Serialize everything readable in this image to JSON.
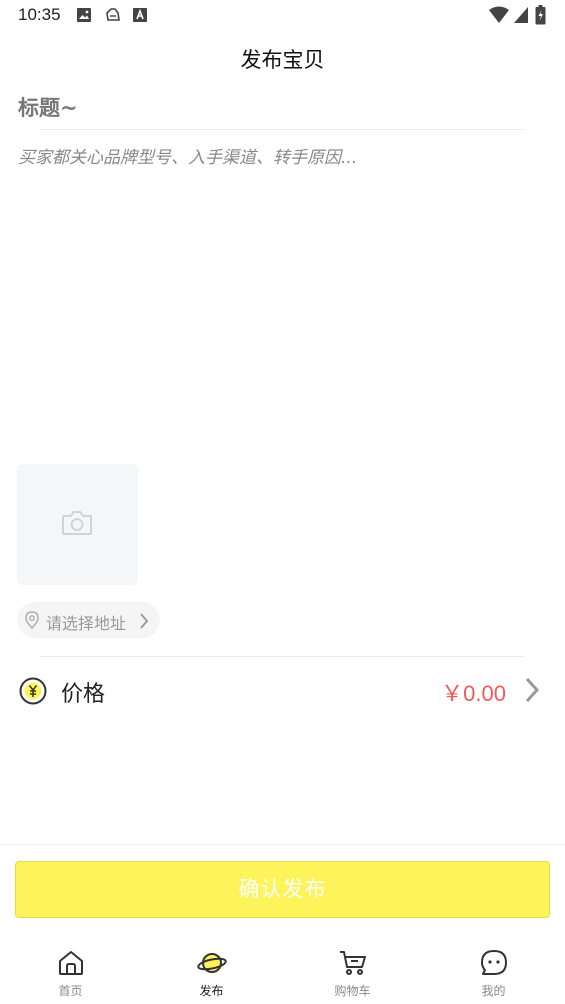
{
  "status_bar": {
    "time": "10:35"
  },
  "header": {
    "title": "发布宝贝"
  },
  "form": {
    "title_placeholder": "标题~",
    "description_placeholder": "买家都关心品牌型号、入手渠道、转手原因...",
    "location_label": "请选择地址",
    "price_label": "价格",
    "price_value": "￥0.00",
    "confirm_button": "确认发布"
  },
  "tabbar": {
    "items": [
      {
        "label": "首页",
        "icon": "home-icon",
        "active": false
      },
      {
        "label": "发布",
        "icon": "planet-icon",
        "active": true
      },
      {
        "label": "购物车",
        "icon": "cart-icon",
        "active": false
      },
      {
        "label": "我的",
        "icon": "chat-smile-icon",
        "active": false
      }
    ]
  },
  "colors": {
    "accent_yellow": "#fdf45c",
    "price_red": "#f05a5a"
  }
}
